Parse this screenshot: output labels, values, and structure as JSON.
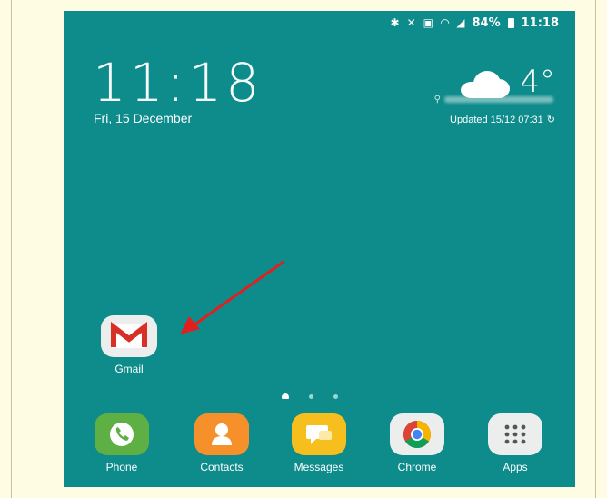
{
  "status_bar": {
    "icons": [
      "bluetooth-icon",
      "mute-icon",
      "nfc-icon",
      "wifi-icon",
      "signal-icon"
    ],
    "battery": "84%",
    "time": "11:18"
  },
  "clock_widget": {
    "time": "11:18",
    "date": "Fri, 15 December"
  },
  "weather_widget": {
    "icon": "cloud-icon",
    "temperature": "4°",
    "updated": "Updated 15/12 07:31"
  },
  "home_apps": [
    {
      "label": "Gmail",
      "icon": "gmail-icon"
    }
  ],
  "page_indicator": {
    "pages": 3,
    "current": "home"
  },
  "dock": [
    {
      "label": "Phone",
      "icon": "phone-icon"
    },
    {
      "label": "Contacts",
      "icon": "contacts-icon"
    },
    {
      "label": "Messages",
      "icon": "messages-icon"
    },
    {
      "label": "Chrome",
      "icon": "chrome-icon"
    },
    {
      "label": "Apps",
      "icon": "apps-grid-icon"
    }
  ],
  "colors": {
    "wallpaper": "#0e8b8b",
    "annotation_arrow": "#e02020",
    "page_border": "#fefde3"
  }
}
